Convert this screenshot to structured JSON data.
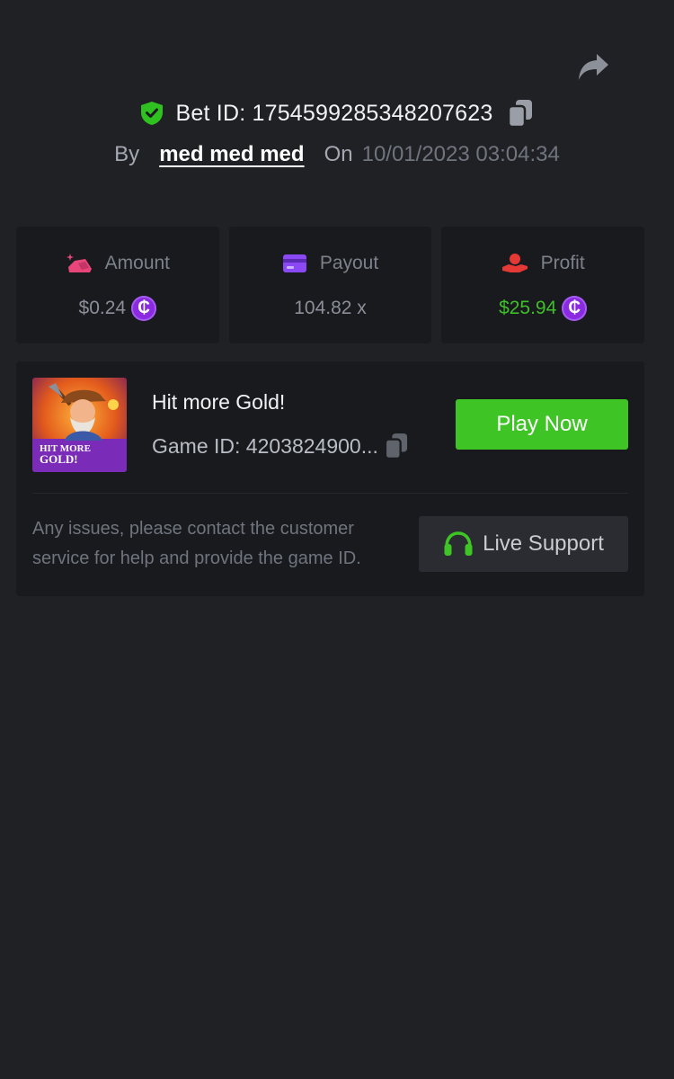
{
  "header": {
    "bet_id": "Bet ID: 1754599285348207623",
    "by_label": "By",
    "username": "med med med",
    "on_label": "On",
    "datetime": "10/01/2023 03:04:34"
  },
  "stats": [
    {
      "label": "Amount",
      "value": "$0.24",
      "icon": "amount-icon",
      "has_coin": true
    },
    {
      "label": "Payout",
      "value": "104.82 x",
      "icon": "card-icon",
      "has_coin": false
    },
    {
      "label": "Profit",
      "value": "$25.94",
      "icon": "profit-hand-icon",
      "has_coin": true
    }
  ],
  "coin_symbol": "₵",
  "game": {
    "title": "Hit more Gold!",
    "game_id": "Game ID: 4203824900...",
    "play_label": "Play Now",
    "thumb_text_line1": "HIT MORE",
    "thumb_text_line2": "GOLD!",
    "help_text": "Any issues, please contact the customer service for help and provide the game ID.",
    "support_label": "Live Support"
  },
  "colors": {
    "background": "#202125",
    "card": "#191a1d",
    "accent_green": "#3fc425",
    "profit_green": "#3fbf2a",
    "coin_purple": "#8a2be2",
    "amount_pink": "#e8457a",
    "payout_purple": "#8a49f5",
    "profit_red": "#e53935"
  }
}
